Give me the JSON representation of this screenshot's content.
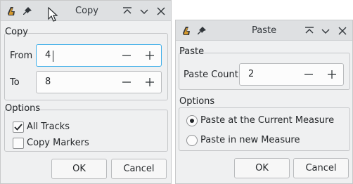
{
  "copy_dialog": {
    "title": "Copy",
    "copy_group_label": "Copy",
    "from_label": "From",
    "from_value": "4",
    "to_label": "To",
    "to_value": "8",
    "options_group_label": "Options",
    "all_tracks_label": "All Tracks",
    "all_tracks_checked": true,
    "copy_markers_label": "Copy Markers",
    "copy_markers_checked": false,
    "ok_label": "OK",
    "cancel_label": "Cancel"
  },
  "paste_dialog": {
    "title": "Paste",
    "paste_group_label": "Paste",
    "paste_count_label": "Paste Count",
    "paste_count_value": "2",
    "options_group_label": "Options",
    "options": [
      {
        "label": "Paste at the Current Measure",
        "selected": true
      },
      {
        "label": "Paste in new Measure",
        "selected": false
      }
    ],
    "ok_label": "OK",
    "cancel_label": "Cancel"
  },
  "colors": {
    "window_bg": "#eff0f1",
    "titlebar_bg": "#dee0e2",
    "focus_accent": "#3daee9",
    "text": "#232629"
  },
  "icons": [
    "app-icon",
    "pin-icon",
    "keep-above-icon",
    "minimize-icon",
    "close-icon",
    "minus-icon",
    "plus-icon",
    "check-icon",
    "mouse-cursor-icon"
  ]
}
